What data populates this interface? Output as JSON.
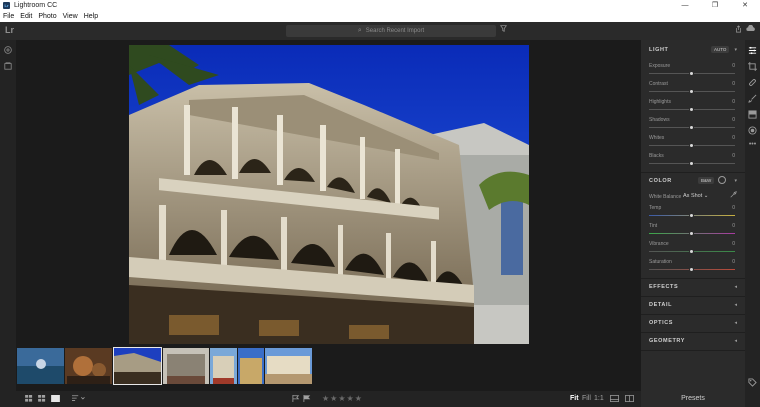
{
  "window": {
    "app_icon": "Lr",
    "title": "Lightroom CC",
    "controls": [
      "—",
      "❐",
      "✕"
    ]
  },
  "menu": [
    "File",
    "Edit",
    "Photo",
    "View",
    "Help"
  ],
  "toolbar": {
    "logo": "Lr",
    "search_placeholder": "Search Recent Import",
    "icons": [
      "search-icon",
      "filter-icon",
      "share-icon",
      "cloud-icon"
    ]
  },
  "left_rail": {
    "icons": [
      "add-photos-icon",
      "library-icon"
    ]
  },
  "right_panel": {
    "light": {
      "title": "LIGHT",
      "auto_label": "AUTO",
      "sliders": [
        {
          "label": "Exposure",
          "value": "0",
          "position": 0.5
        },
        {
          "label": "Contrast",
          "value": "0",
          "position": 0.5
        },
        {
          "label": "Highlights",
          "value": "0",
          "position": 0.5
        },
        {
          "label": "Shadows",
          "value": "0",
          "position": 0.5
        },
        {
          "label": "Whites",
          "value": "0",
          "position": 0.5
        },
        {
          "label": "Blacks",
          "value": "0",
          "position": 0.5
        }
      ]
    },
    "color": {
      "title": "COLOR",
      "bw_label": "B&W",
      "white_balance_label": "White Balance",
      "white_balance_value": "As Shot",
      "sliders": [
        {
          "label": "Temp",
          "value": "0",
          "position": 0.5
        },
        {
          "label": "Tint",
          "value": "0",
          "position": 0.5
        },
        {
          "label": "Vibrance",
          "value": "0",
          "position": 0.5
        },
        {
          "label": "Saturation",
          "value": "0",
          "position": 0.5
        }
      ]
    },
    "collapsed_sections": [
      "EFFECTS",
      "DETAIL",
      "OPTICS",
      "GEOMETRY"
    ]
  },
  "right_rail": {
    "icons": [
      "edit-sliders-icon",
      "crop-icon",
      "healing-brush-icon",
      "brush-icon",
      "linear-gradient-icon",
      "radial-gradient-icon",
      "more-icon",
      "tag-icon",
      "info-icon"
    ]
  },
  "bottom_bar": {
    "view_icons": [
      "grid-view-icon",
      "square-grid-view-icon",
      "detail-view-icon",
      "sort-icon"
    ],
    "flag_icons": [
      "pick-flag-icon",
      "reject-flag-icon"
    ],
    "stars": "★★★★★",
    "zoom_fit": "Fit",
    "zoom_fill": "Fill",
    "zoom_1to1": "1:1",
    "compare_icons": [
      "filmstrip-icon",
      "compare-icon"
    ],
    "presets_label": "Presets"
  },
  "filmstrip": {
    "count": 6,
    "selected_index": 2
  }
}
